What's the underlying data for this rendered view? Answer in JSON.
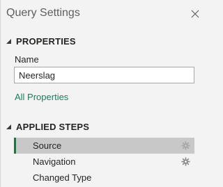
{
  "pane": {
    "title": "Query Settings",
    "close_icon": "close-icon"
  },
  "properties": {
    "section_label": "PROPERTIES",
    "name_label": "Name",
    "name_value": "Neerslag",
    "all_properties_link": "All Properties"
  },
  "applied_steps": {
    "section_label": "APPLIED STEPS",
    "steps": [
      {
        "label": "Source",
        "selected": true,
        "has_settings": true
      },
      {
        "label": "Navigation",
        "selected": false,
        "has_settings": true
      },
      {
        "label": "Changed Type",
        "selected": false,
        "has_settings": false
      }
    ]
  },
  "colors": {
    "background": "#f3f3f3",
    "link": "#1a7f5a",
    "selected_step_bg": "#c8c8c8",
    "selected_step_accent": "#217346"
  }
}
